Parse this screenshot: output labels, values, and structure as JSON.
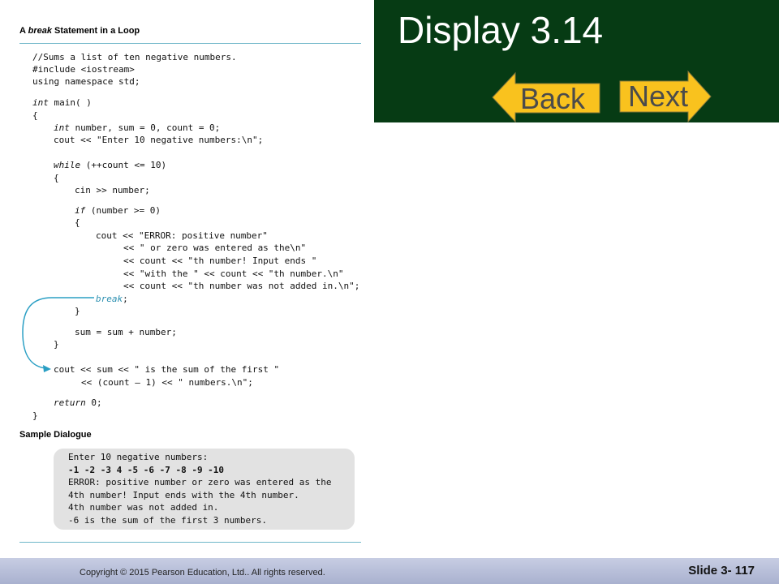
{
  "slide": {
    "title": "Display 3.14",
    "back_label": "Back",
    "next_label": "Next"
  },
  "panel": {
    "title_prefix": "A ",
    "title_keyword": "break",
    "title_suffix": " Statement in a Loop",
    "code": [
      "//Sums a list of ten negative numbers.",
      "#include <iostream>",
      "using namespace std;",
      "int",
      " main( )",
      "{",
      "int",
      " number, sum = 0, count = 0;",
      "cout << \"Enter 10 negative numbers:\\n\";",
      "while",
      " (++count <= 10)",
      "{",
      "cin >> number;",
      "if",
      " (number >= 0)",
      "{",
      "cout << \"ERROR: positive number\"",
      "<< \" or zero was entered as the\\n\"",
      "<< count << \"th number! Input ends \"",
      "<< \"with the \" << count << \"th number.\\n\"",
      "<< count << \"th number was not added in.\\n\";",
      "break",
      ";",
      "}",
      "sum = sum + number;",
      "}",
      "cout << sum << \" is the sum of the first \"",
      "<< (count – 1) << \" numbers.\\n\";",
      "return",
      " 0;",
      "}"
    ],
    "sample_heading": "Sample Dialogue",
    "dialogue": [
      "Enter 10 negative numbers:",
      "-1 -2 -3 4 -5 -6 -7 -8 -9 -10",
      "ERROR: positive number or zero was entered as the",
      "4th number! Input ends with the 4th number.",
      "4th number was not added in.",
      "-6 is the sum of the first 3 numbers."
    ]
  },
  "footer": {
    "copyright": "Copyright © 2015 Pearson Education, Ltd..  All rights reserved.",
    "slide_number": "Slide 3- 117"
  },
  "colors": {
    "header_band": "#063b14",
    "button_fill": "#f9c21e",
    "footer": "#b7bed9",
    "arrow": "#2a9fc4"
  }
}
